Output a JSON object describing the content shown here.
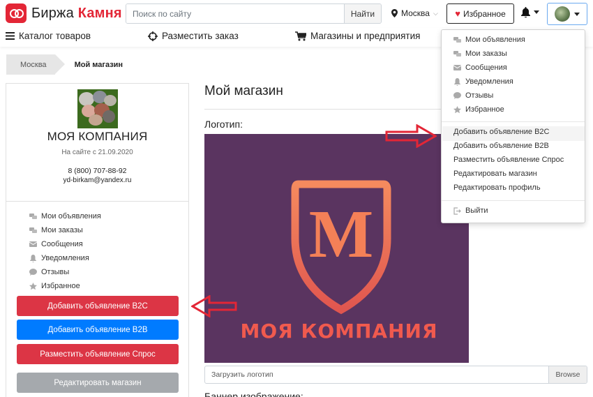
{
  "header": {
    "logo_text_1": "Биржа",
    "logo_text_2": "Камня",
    "search_placeholder": "Поиск по сайту",
    "search_button": "Найти",
    "city": "Москва",
    "favorites": "Избранное"
  },
  "nav": {
    "catalog": "Каталог товаров",
    "order": "Разместить заказ",
    "shops": "Магазины и предприятия"
  },
  "breadcrumb": {
    "city": "Москва",
    "current": "Мой магазин"
  },
  "company": {
    "name": "МОЯ КОМПАНИЯ",
    "since": "На сайте с 21.09.2020",
    "phone": "8 (800) 707-88-92",
    "email": "yd-birkam@yandex.ru"
  },
  "side_menu": [
    {
      "label": "Мои объявления",
      "icon": "ads-icon"
    },
    {
      "label": "Мои заказы",
      "icon": "orders-icon"
    },
    {
      "label": "Сообщения",
      "icon": "envelope-icon"
    },
    {
      "label": "Уведомления",
      "icon": "bell-icon"
    },
    {
      "label": "Отзывы",
      "icon": "comment-icon"
    },
    {
      "label": "Избранное",
      "icon": "star-icon"
    }
  ],
  "side_buttons": {
    "add_b2c": "Добавить объявление B2C",
    "add_b2b": "Добавить объявление B2B",
    "place_demand": "Разместить объявление Спрос",
    "edit_shop": "Редактировать магазин"
  },
  "main": {
    "title": "Мой магазин",
    "logo_label": "Логотип:",
    "logo_image_text_letter": "M",
    "logo_image_text_name": "МОЯ КОМПАНИЯ",
    "upload_placeholder": "Загрузить логотип",
    "browse": "Browse",
    "next_label": "Баннер изображение:"
  },
  "dropdown": {
    "group1": [
      {
        "label": "Мои объявления",
        "icon": "ads-icon"
      },
      {
        "label": "Мои заказы",
        "icon": "orders-icon"
      },
      {
        "label": "Сообщения",
        "icon": "envelope-icon"
      },
      {
        "label": "Уведомления",
        "icon": "bell-icon"
      },
      {
        "label": "Отзывы",
        "icon": "comment-icon"
      },
      {
        "label": "Избранное",
        "icon": "star-icon"
      }
    ],
    "group2": [
      {
        "label": "Добавить объявление B2C"
      },
      {
        "label": "Добавить объявление B2B"
      },
      {
        "label": "Разместить объявление Спрос"
      },
      {
        "label": "Редактировать магазин"
      },
      {
        "label": "Редактировать профиль"
      }
    ],
    "logout": "Выйти"
  },
  "colors": {
    "brand_red": "#e32636",
    "btn_red": "#dc3545",
    "btn_blue": "#007bff",
    "btn_gray": "#a5a9ad",
    "logo_bg": "#5a3460",
    "logo_accent": "#f07a5a"
  }
}
